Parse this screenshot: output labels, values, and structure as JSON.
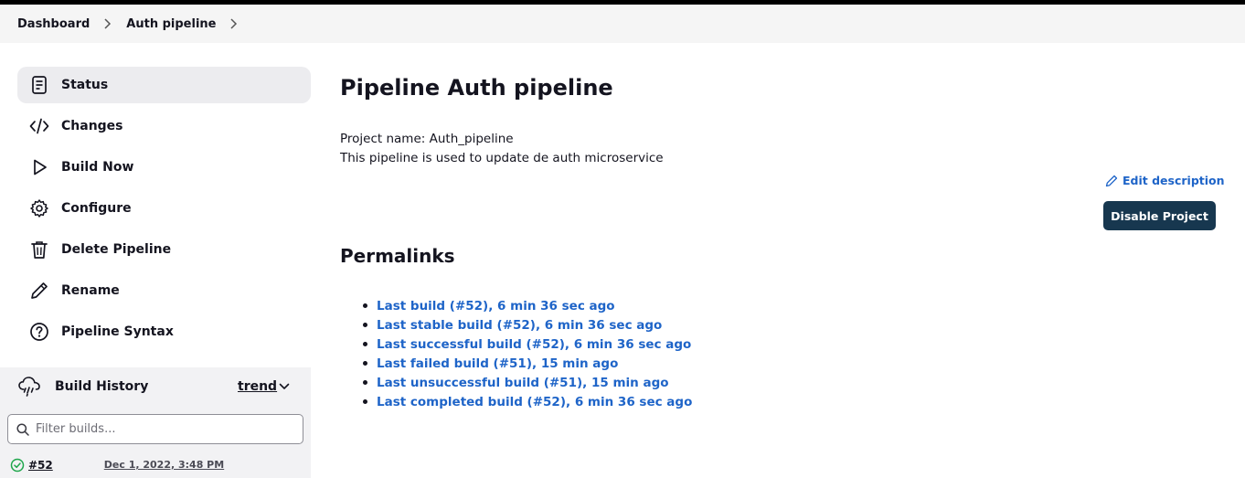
{
  "breadcrumb": [
    "Dashboard",
    "Auth pipeline"
  ],
  "sidebar": {
    "items": [
      {
        "label": "Status",
        "icon": "document-icon"
      },
      {
        "label": "Changes",
        "icon": "code-icon"
      },
      {
        "label": "Build Now",
        "icon": "play-icon"
      },
      {
        "label": "Configure",
        "icon": "gear-icon"
      },
      {
        "label": "Delete Pipeline",
        "icon": "trash-icon"
      },
      {
        "label": "Rename",
        "icon": "pencil-icon"
      },
      {
        "label": "Pipeline Syntax",
        "icon": "help-icon"
      }
    ]
  },
  "build_history": {
    "title": "Build History",
    "trend_label": "trend",
    "filter_placeholder": "Filter builds...",
    "builds": [
      {
        "number": "#52",
        "date": "Dec 1, 2022, 3:48 PM",
        "status": "success"
      }
    ]
  },
  "main": {
    "title": "Pipeline Auth pipeline",
    "project_name_line": "Project name: Auth_pipeline",
    "description": "This pipeline is used to update de auth microservice",
    "edit_description_label": "Edit description",
    "disable_button_label": "Disable Project",
    "permalinks_title": "Permalinks",
    "permalinks": [
      "Last build (#52), 6 min 36 sec ago",
      "Last stable build (#52), 6 min 36 sec ago",
      "Last successful build (#52), 6 min 36 sec ago",
      "Last failed build (#51), 15 min ago",
      "Last unsuccessful build (#51), 15 min ago",
      "Last completed build (#52), 6 min 36 sec ago"
    ]
  },
  "colors": {
    "link": "#1e64c8",
    "primary_button": "#17374f",
    "active_nav": "#ececef",
    "success": "#1ea64b"
  }
}
